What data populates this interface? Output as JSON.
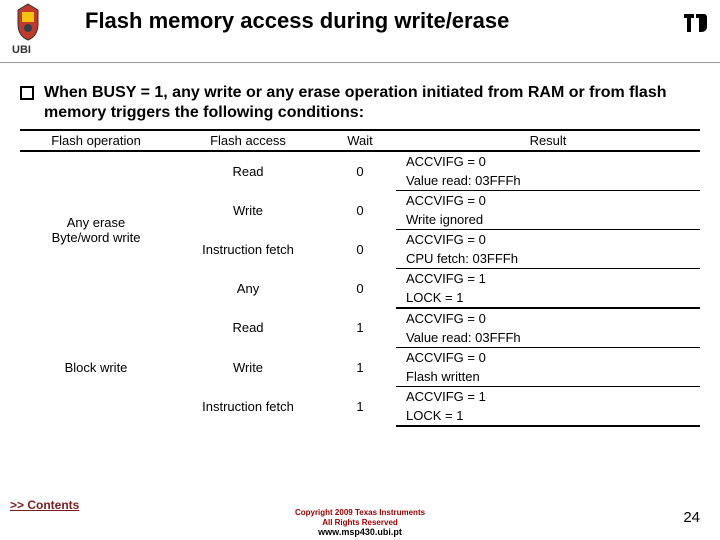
{
  "header": {
    "title": "Flash memory access during write/erase",
    "ubi": "UBI"
  },
  "bullet": "When BUSY = 1, any write or any erase operation initiated from RAM or from flash memory triggers the following conditions:",
  "table": {
    "headers": [
      "Flash operation",
      "Flash access",
      "Wait",
      "Result"
    ],
    "op1": "Any erase",
    "op1b": "Byte/word write",
    "op2": "Block write",
    "rows": [
      {
        "access": "Read",
        "wait": "0",
        "r1": "ACCVIFG = 0",
        "r2": "Value read: 03FFFh"
      },
      {
        "access": "Write",
        "wait": "0",
        "r1": "ACCVIFG = 0",
        "r2": "Write ignored"
      },
      {
        "access": "Instruction fetch",
        "wait": "0",
        "r1": "ACCVIFG = 0",
        "r2": "CPU fetch: 03FFFh"
      },
      {
        "access": "Any",
        "wait": "0",
        "r1": "ACCVIFG = 1",
        "r2": "LOCK = 1"
      },
      {
        "access": "Read",
        "wait": "1",
        "r1": "ACCVIFG = 0",
        "r2": "Value read: 03FFFh"
      },
      {
        "access": "Write",
        "wait": "1",
        "r1": "ACCVIFG = 0",
        "r2": "Flash written"
      },
      {
        "access": "Instruction fetch",
        "wait": "1",
        "r1": "ACCVIFG = 1",
        "r2": "LOCK = 1"
      }
    ]
  },
  "contents": ">> Contents",
  "footer": {
    "copyright": "Copyright 2009 Texas Instruments",
    "rights": "All Rights Reserved",
    "url": "www.msp430.ubi.pt"
  },
  "page": "24"
}
